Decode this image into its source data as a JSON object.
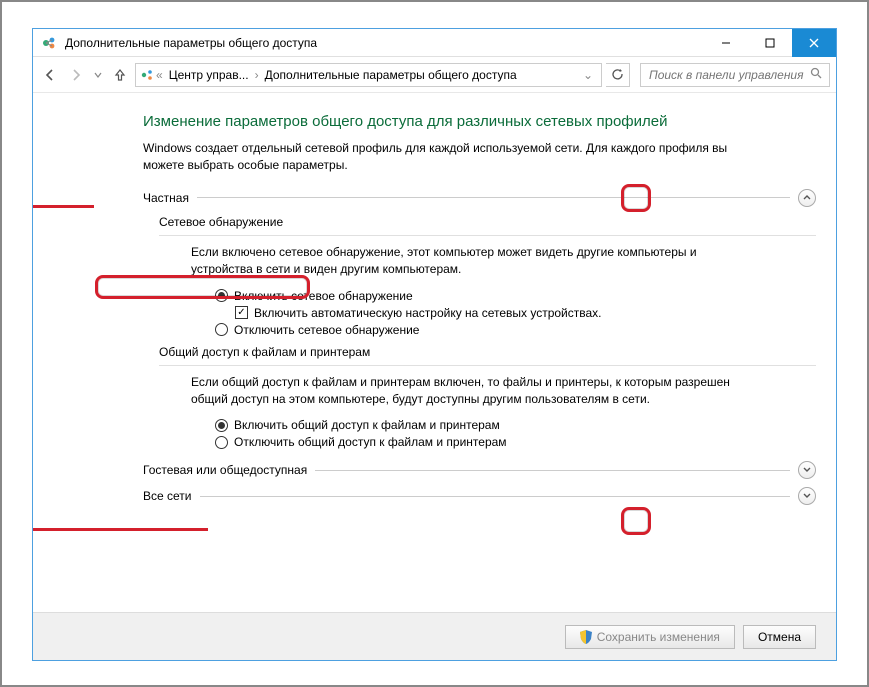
{
  "window": {
    "title": "Дополнительные параметры общего доступа"
  },
  "nav": {
    "crumb1": "Центр управ...",
    "crumb2": "Дополнительные параметры общего доступа",
    "search_placeholder": "Поиск в панели управления"
  },
  "page": {
    "heading": "Изменение параметров общего доступа для различных сетевых профилей",
    "description": "Windows создает отдельный сетевой профиль для каждой используемой сети. Для каждого профиля вы можете выбрать особые параметры."
  },
  "sections": {
    "private": {
      "label": "Частная",
      "discovery": {
        "title": "Сетевое обнаружение",
        "explain": "Если включено сетевое обнаружение, этот компьютер может видеть другие компьютеры и устройства в сети и виден другим компьютерам.",
        "opt_on": "Включить сетевое обнаружение",
        "opt_auto": "Включить автоматическую настройку на сетевых устройствах.",
        "opt_off": "Отключить сетевое обнаружение"
      },
      "fileshare": {
        "title": "Общий доступ к файлам и принтерам",
        "explain": "Если общий доступ к файлам и принтерам включен, то файлы и принтеры, к которым разрешен общий доступ на этом компьютере, будут доступны другим пользователям в сети.",
        "opt_on": "Включить общий доступ к файлам и принтерам",
        "opt_off": "Отключить общий доступ к файлам и принтерам"
      }
    },
    "guest": {
      "label": "Гостевая или общедоступная"
    },
    "all": {
      "label": "Все сети"
    }
  },
  "buttons": {
    "save": "Сохранить изменения",
    "cancel": "Отмена"
  }
}
